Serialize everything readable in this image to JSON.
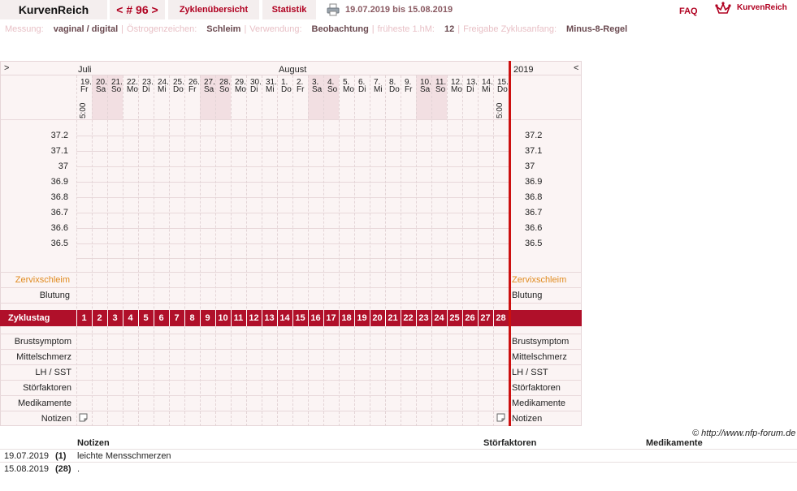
{
  "topbar": {
    "brand": "KurvenReich",
    "cycle": "< # 96 >",
    "overview": "Zyklenübersicht",
    "stats": "Statistik",
    "daterange": "19.07.2019 bis 15.08.2019",
    "faq": "FAQ",
    "logo": "KurvenReich"
  },
  "info": [
    {
      "k": "Messung:",
      "v": "vaginal / digital"
    },
    {
      "k": "Östrogenzeichen:",
      "v": "Schleim"
    },
    {
      "k": "Verwendung:",
      "v": "Beobachtung"
    },
    {
      "k": "früheste 1.hM:",
      "v": "12"
    },
    {
      "k": "Freigabe Zyklusanfang:",
      "v": "Minus-8-Regel"
    }
  ],
  "header": {
    "left_arrow": ">",
    "right_arrow": "<",
    "month1": "Juli",
    "month2": "August",
    "year": "2019",
    "time_first": "5:00",
    "time_last": "5:00"
  },
  "days": [
    {
      "d": "19.",
      "w": "Fr",
      "we": false
    },
    {
      "d": "20.",
      "w": "Sa",
      "we": true
    },
    {
      "d": "21.",
      "w": "So",
      "we": true
    },
    {
      "d": "22.",
      "w": "Mo",
      "we": false
    },
    {
      "d": "23.",
      "w": "Di",
      "we": false
    },
    {
      "d": "24.",
      "w": "Mi",
      "we": false
    },
    {
      "d": "25.",
      "w": "Do",
      "we": false
    },
    {
      "d": "26.",
      "w": "Fr",
      "we": false
    },
    {
      "d": "27.",
      "w": "Sa",
      "we": true
    },
    {
      "d": "28.",
      "w": "So",
      "we": true
    },
    {
      "d": "29.",
      "w": "Mo",
      "we": false
    },
    {
      "d": "30.",
      "w": "Di",
      "we": false
    },
    {
      "d": "31.",
      "w": "Mi",
      "we": false
    },
    {
      "d": "1.",
      "w": "Do",
      "we": false
    },
    {
      "d": "2.",
      "w": "Fr",
      "we": false
    },
    {
      "d": "3.",
      "w": "Sa",
      "we": true
    },
    {
      "d": "4.",
      "w": "So",
      "we": true
    },
    {
      "d": "5.",
      "w": "Mo",
      "we": false
    },
    {
      "d": "6.",
      "w": "Di",
      "we": false
    },
    {
      "d": "7.",
      "w": "Mi",
      "we": false
    },
    {
      "d": "8.",
      "w": "Do",
      "we": false
    },
    {
      "d": "9.",
      "w": "Fr",
      "we": false
    },
    {
      "d": "10.",
      "w": "Sa",
      "we": true
    },
    {
      "d": "11.",
      "w": "So",
      "we": true
    },
    {
      "d": "12.",
      "w": "Mo",
      "we": false
    },
    {
      "d": "13.",
      "w": "Di",
      "we": false
    },
    {
      "d": "14.",
      "w": "Mi",
      "we": false
    },
    {
      "d": "15.",
      "w": "Do",
      "we": false
    }
  ],
  "temps": [
    "37.2",
    "37.1",
    "37",
    "36.9",
    "36.8",
    "36.7",
    "36.6",
    "36.5"
  ],
  "rows_upper": [
    {
      "label": "Zervixschleim",
      "color": "#e08a1e"
    },
    {
      "label": "Blutung",
      "color": "#222222"
    }
  ],
  "zyklustag_label": "Zyklustag",
  "cycle_days": [
    "1",
    "2",
    "3",
    "4",
    "5",
    "6",
    "7",
    "8",
    "9",
    "10",
    "11",
    "12",
    "13",
    "14",
    "15",
    "16",
    "17",
    "18",
    "19",
    "20",
    "21",
    "22",
    "23",
    "24",
    "25",
    "26",
    "27",
    "28"
  ],
  "rows_lower": [
    "Brustsymptom",
    "Mittelschmerz",
    "LH / SST",
    "Störfaktoren",
    "Medikamente",
    "Notizen"
  ],
  "copyright": "© http://www.nfp-forum.de",
  "notes": {
    "headers": {
      "notes": "Notizen",
      "factors": "Störfaktoren",
      "meds": "Medikamente"
    },
    "rows": [
      {
        "date": "19.07.2019",
        "day": "(1)",
        "note": "leichte Mensschmerzen"
      },
      {
        "date": "15.08.2019",
        "day": "(28)",
        "note": "."
      }
    ]
  },
  "colors": {
    "accent": "#b00020",
    "band": "#b0102a",
    "weekend": "#f2dfe2",
    "panel": "#fbf4f4"
  }
}
